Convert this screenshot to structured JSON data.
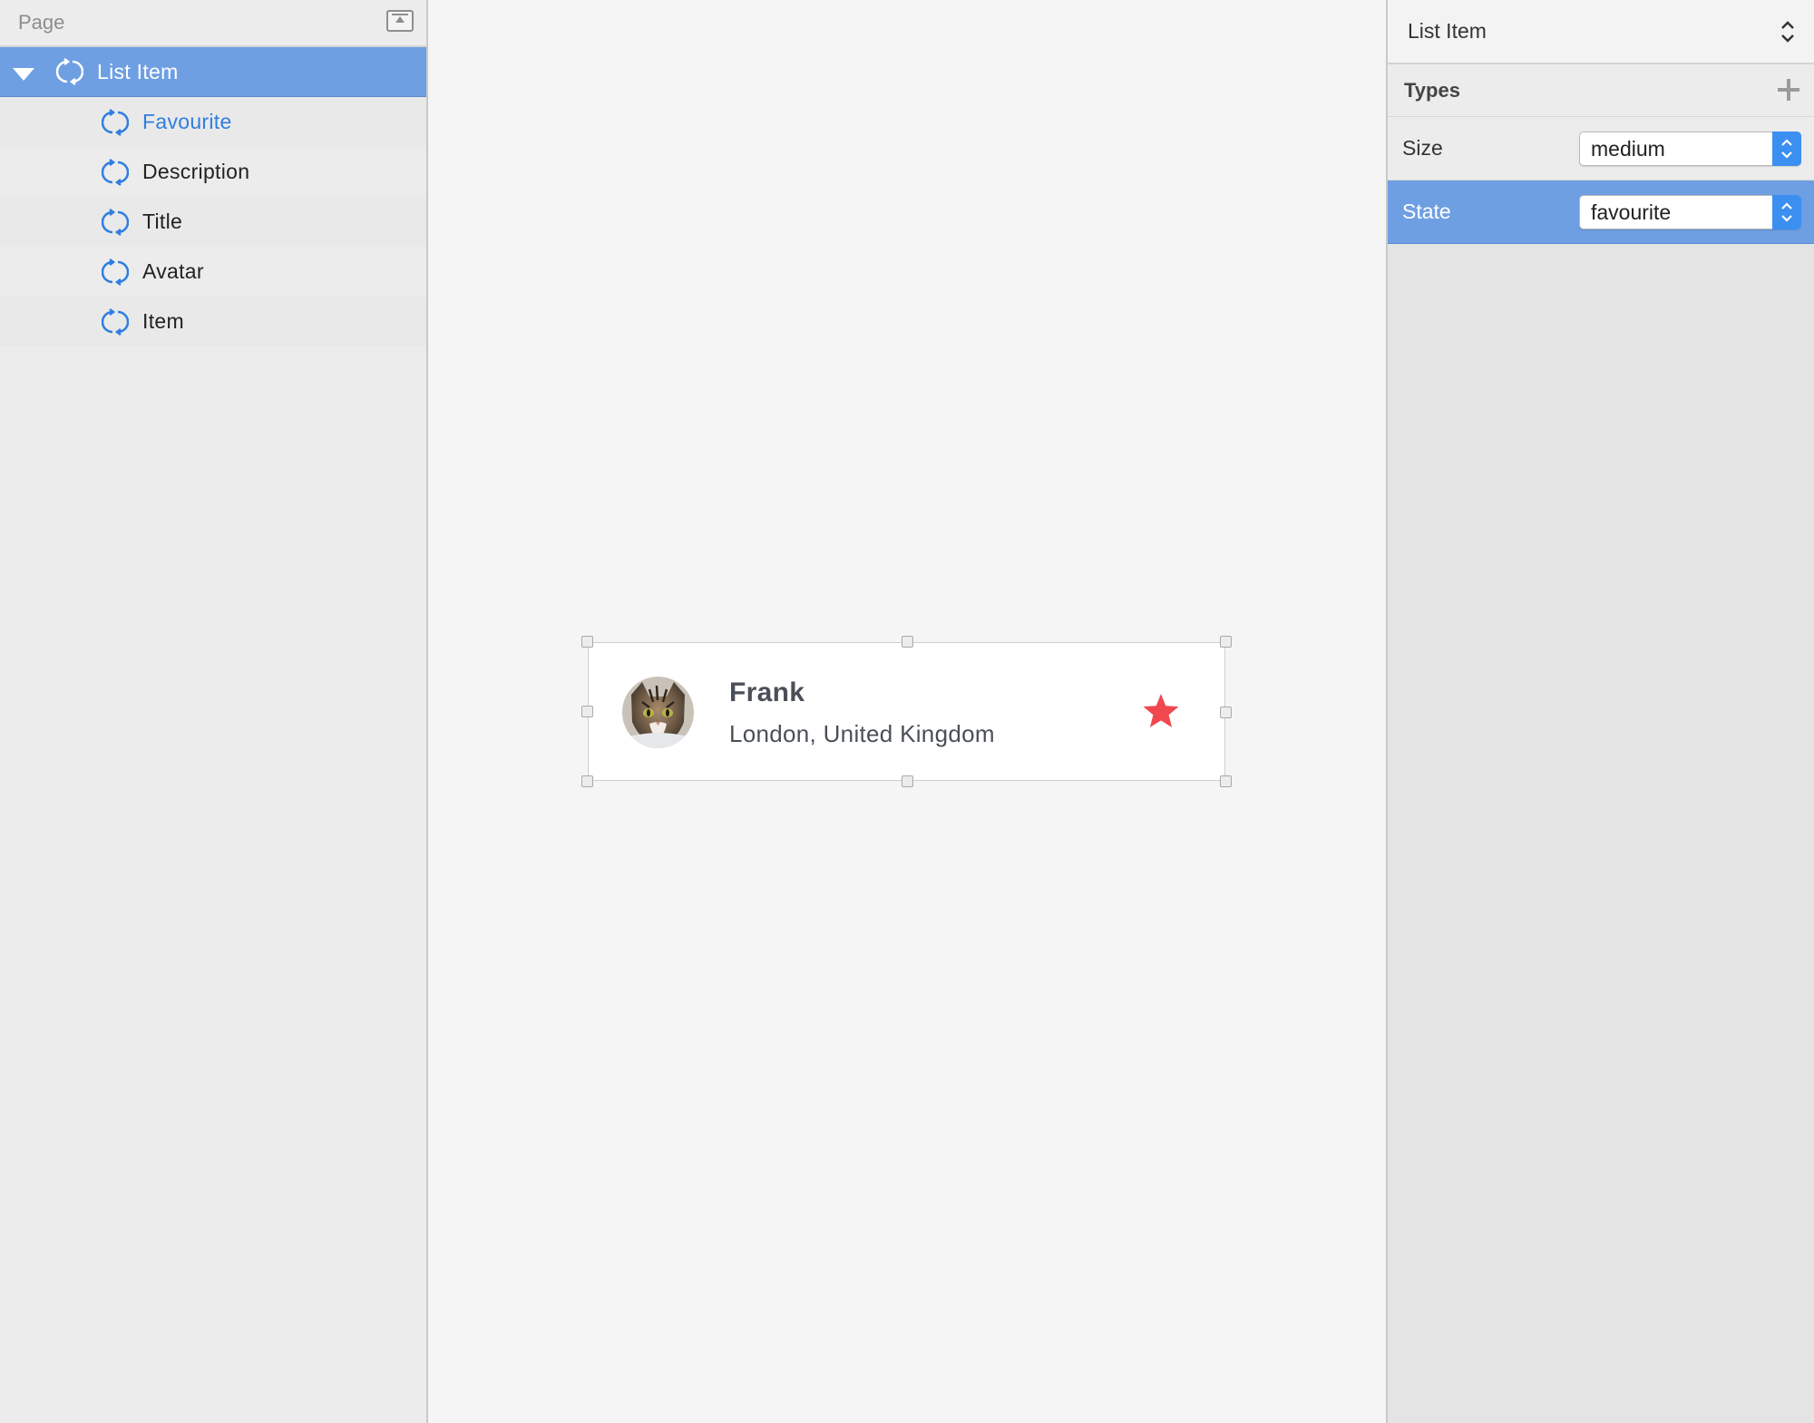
{
  "left_panel": {
    "page_label": "Page",
    "layers": [
      {
        "label": "List Item",
        "icon": "symbol-icon",
        "selected": true,
        "expanded": true
      },
      {
        "label": "Favourite",
        "icon": "symbol-icon",
        "active": true
      },
      {
        "label": "Description",
        "icon": "symbol-icon"
      },
      {
        "label": "Title",
        "icon": "symbol-icon"
      },
      {
        "label": "Avatar",
        "icon": "symbol-icon"
      },
      {
        "label": "Item",
        "icon": "symbol-icon"
      }
    ]
  },
  "canvas": {
    "list_item": {
      "title": "Frank",
      "description": "London, United Kingdom",
      "avatar": "cat-photo",
      "favourite_icon": "star-icon",
      "favourite_color": "#f0484e"
    }
  },
  "inspector": {
    "symbol_name": "List Item",
    "types_label": "Types",
    "properties": [
      {
        "label": "Size",
        "value": "medium",
        "selected": false
      },
      {
        "label": "State",
        "value": "favourite",
        "selected": true
      }
    ]
  },
  "colors": {
    "selection": "#6e9fe3",
    "accent": "#2f7ee0",
    "stepper": "#3b8ff0"
  }
}
